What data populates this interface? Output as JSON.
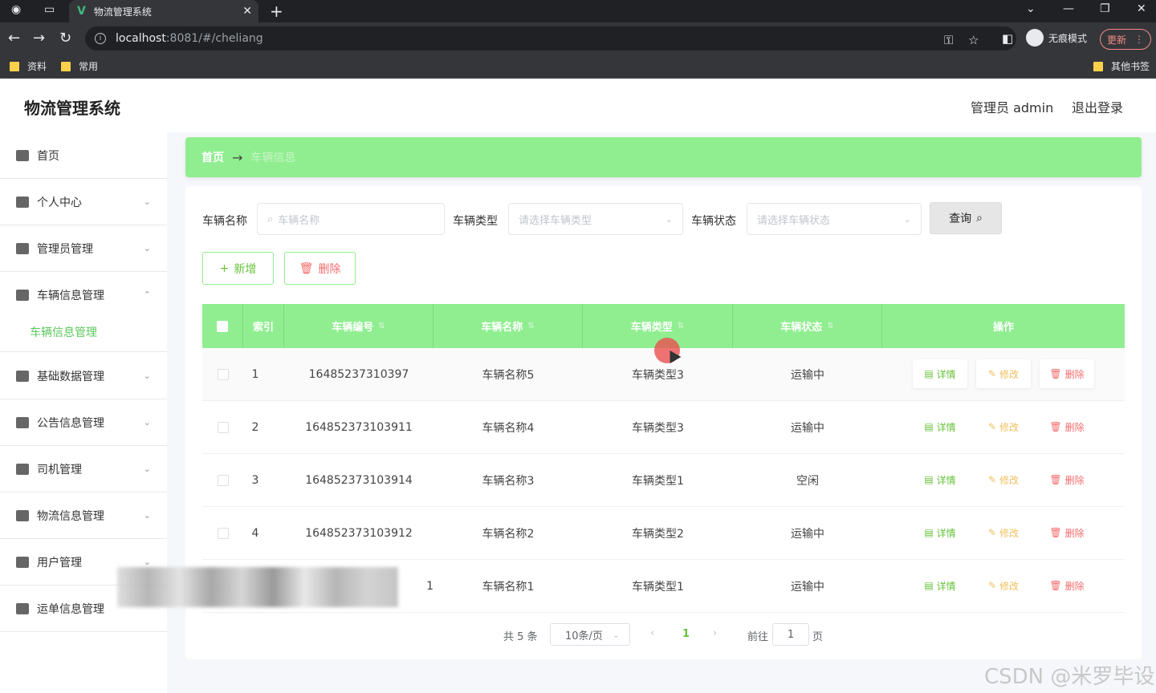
{
  "browser": {
    "tab_title": "物流管理系统",
    "url_host": "localhost",
    "url_rest": ":8081/#/cheliang",
    "incognito_label": "无痕模式",
    "update_label": "更新",
    "bookmarks": [
      "资料",
      "常用"
    ],
    "other_bookmarks": "其他书签"
  },
  "app": {
    "title": "物流管理系统",
    "user": "管理员 admin",
    "logout": "退出登录"
  },
  "sidebar": {
    "items": [
      {
        "label": "首页",
        "icon": "home-icon"
      },
      {
        "label": "个人中心",
        "icon": "user-icon"
      },
      {
        "label": "管理员管理",
        "icon": "admin-icon"
      },
      {
        "label": "车辆信息管理",
        "icon": "chat-icon"
      },
      {
        "label": "基础数据管理",
        "icon": "flag-icon"
      },
      {
        "label": "公告信息管理",
        "icon": "location-icon"
      },
      {
        "label": "司机管理",
        "icon": "send-icon"
      },
      {
        "label": "物流信息管理",
        "icon": "cup-icon"
      },
      {
        "label": "用户管理",
        "icon": "picture-icon"
      },
      {
        "label": "运单信息管理",
        "icon": "camera-icon"
      }
    ],
    "sub_active": "车辆信息管理"
  },
  "breadcrumb": {
    "home": "首页",
    "arrow": "→",
    "current": "车辆信息"
  },
  "filters": {
    "name_label": "车辆名称",
    "name_placeholder": "车辆名称",
    "type_label": "车辆类型",
    "type_placeholder": "请选择车辆类型",
    "status_label": "车辆状态",
    "status_placeholder": "请选择车辆状态",
    "search_label": "查询"
  },
  "actions": {
    "add_label": "新增",
    "delete_label": "删除"
  },
  "table": {
    "headers": [
      "索引",
      "车辆编号",
      "车辆名称",
      "车辆类型",
      "车辆状态",
      "操作"
    ],
    "rows": [
      {
        "index": "1",
        "code": "16485237310397",
        "name": "车辆名称5",
        "type": "车辆类型3",
        "status": "运输中"
      },
      {
        "index": "2",
        "code": "164852373103911",
        "name": "车辆名称4",
        "type": "车辆类型3",
        "status": "运输中"
      },
      {
        "index": "3",
        "code": "164852373103914",
        "name": "车辆名称3",
        "type": "车辆类型1",
        "status": "空闲"
      },
      {
        "index": "4",
        "code": "164852373103912",
        "name": "车辆名称2",
        "type": "车辆类型2",
        "status": "运输中"
      },
      {
        "index": "",
        "code": "1",
        "name": "车辆名称1",
        "type": "车辆类型1",
        "status": "运输中"
      }
    ],
    "ops": {
      "detail": "详情",
      "edit": "修改",
      "remove": "删除"
    }
  },
  "pagination": {
    "total": "共 5 条",
    "page_size": "10条/页",
    "current_page": "1",
    "goto_label": "前往",
    "goto_value": "1",
    "page_suffix": "页"
  },
  "watermark": "CSDN @米罗毕设"
}
